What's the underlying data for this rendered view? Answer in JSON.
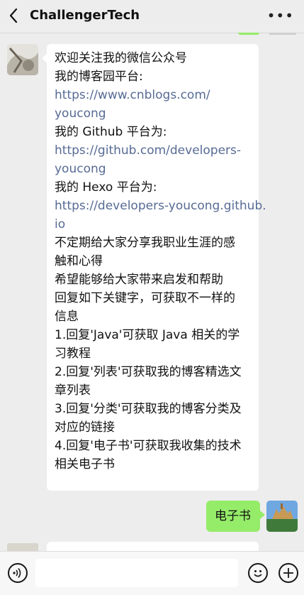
{
  "header": {
    "title": "ChallengerTech"
  },
  "messages": {
    "received_lines": [
      {
        "text": "欢迎关注我的微信公众号",
        "link": false
      },
      {
        "text": "我的博客园平台:",
        "link": false
      },
      {
        "text": "https://www.cnblogs.com/",
        "link": true
      },
      {
        "text": "youcong",
        "link": true
      },
      {
        "text": "我的 Github 平台为:",
        "link": false
      },
      {
        "text": "https://github.com/developers-",
        "link": true
      },
      {
        "text": "youcong",
        "link": true
      },
      {
        "text": "我的 Hexo 平台为:",
        "link": false
      },
      {
        "text": "https://developers-youcong.github.",
        "link": true
      },
      {
        "text": "io",
        "link": true
      },
      {
        "text": "不定期给大家分享我职业生涯的感",
        "link": false
      },
      {
        "text": "触和心得",
        "link": false
      },
      {
        "text": "希望能够给大家带来启发和帮助",
        "link": false
      },
      {
        "text": "回复如下关键字，可获取不一样的",
        "link": false
      },
      {
        "text": "信息",
        "link": false
      },
      {
        "text": "1.回复'Java'可获取 Java 相关的学",
        "link": false
      },
      {
        "text": "习教程",
        "link": false
      },
      {
        "text": "2.回复'列表'可获取我的博客精选文",
        "link": false
      },
      {
        "text": "章列表",
        "link": false
      },
      {
        "text": "3.回复'分类'可获取我的博客分类及",
        "link": false
      },
      {
        "text": "对应的链接",
        "link": false
      },
      {
        "text": "4.回复'电子书'可获取我收集的技术",
        "link": false
      },
      {
        "text": "相关电子书",
        "link": false
      }
    ],
    "sent_text": "电子书"
  },
  "icons": {
    "back": "chevron-left-icon",
    "more": "more-dots-icon",
    "voice": "voice-icon",
    "emoji": "emoji-icon",
    "add": "plus-icon"
  },
  "colors": {
    "background": "#ededed",
    "sent_bubble": "#95ec69",
    "link": "#576b95"
  }
}
